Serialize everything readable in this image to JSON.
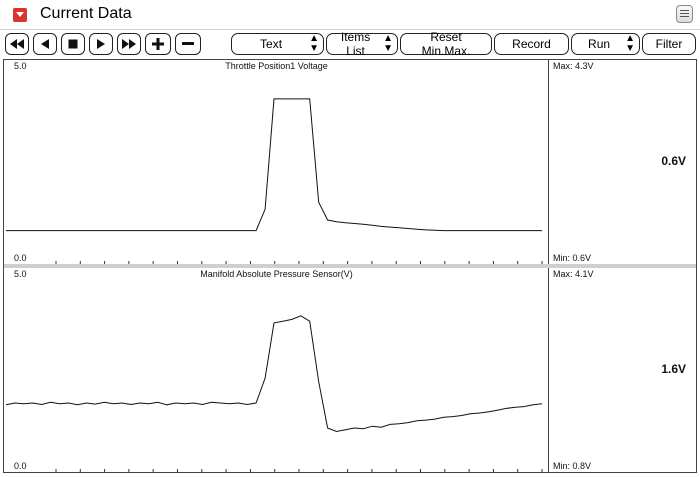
{
  "window": {
    "title": "Current Data"
  },
  "toolbar": {
    "text_select": "Text",
    "items_list": "Items List",
    "reset_label": "Reset Min.Max.",
    "record_label": "Record",
    "run_select": "Run",
    "filter_label": "Filter"
  },
  "panels": [
    {
      "title": "Throttle Position1 Voltage",
      "y_max_label": "5.0",
      "y_min_label": "0.0",
      "max_text": "Max:  4.3V",
      "min_text": "Min:  0.6V",
      "current_value": "0.6V",
      "chart_data": {
        "type": "line",
        "ylim": [
          0,
          5
        ],
        "x": [
          0,
          1,
          2,
          3,
          4,
          5,
          6,
          7,
          8,
          9,
          10,
          11,
          12,
          13,
          14,
          15,
          16,
          17,
          18,
          19,
          20,
          21,
          22,
          23,
          24,
          25,
          26,
          27,
          28,
          29,
          30,
          31,
          32,
          33,
          34,
          35,
          36,
          37,
          38,
          39,
          40,
          41,
          42,
          43,
          44,
          45,
          46,
          47,
          48,
          49,
          50,
          51,
          52,
          53,
          54,
          55,
          56,
          57,
          58,
          59,
          60
        ],
        "values": [
          0.6,
          0.6,
          0.6,
          0.6,
          0.6,
          0.6,
          0.6,
          0.6,
          0.6,
          0.6,
          0.6,
          0.6,
          0.6,
          0.6,
          0.6,
          0.6,
          0.6,
          0.6,
          0.6,
          0.6,
          0.6,
          0.6,
          0.6,
          0.6,
          0.6,
          0.6,
          0.6,
          0.6,
          0.6,
          1.2,
          4.3,
          4.3,
          4.3,
          4.3,
          4.3,
          1.4,
          0.9,
          0.85,
          0.82,
          0.8,
          0.78,
          0.75,
          0.72,
          0.7,
          0.68,
          0.66,
          0.64,
          0.62,
          0.61,
          0.6,
          0.6,
          0.6,
          0.6,
          0.6,
          0.6,
          0.6,
          0.6,
          0.6,
          0.6,
          0.6,
          0.6
        ]
      }
    },
    {
      "title": "Manifold Absolute Pressure Sensor(V)",
      "y_max_label": "5.0",
      "y_min_label": "0.0",
      "max_text": "Max:  4.1V",
      "min_text": "Min:  0.8V",
      "current_value": "1.6V",
      "chart_data": {
        "type": "line",
        "ylim": [
          0,
          5
        ],
        "x": [
          0,
          1,
          2,
          3,
          4,
          5,
          6,
          7,
          8,
          9,
          10,
          11,
          12,
          13,
          14,
          15,
          16,
          17,
          18,
          19,
          20,
          21,
          22,
          23,
          24,
          25,
          26,
          27,
          28,
          29,
          30,
          31,
          32,
          33,
          34,
          35,
          36,
          37,
          38,
          39,
          40,
          41,
          42,
          43,
          44,
          45,
          46,
          47,
          48,
          49,
          50,
          51,
          52,
          53,
          54,
          55,
          56,
          57,
          58,
          59,
          60
        ],
        "values": [
          1.55,
          1.6,
          1.58,
          1.6,
          1.56,
          1.62,
          1.58,
          1.6,
          1.55,
          1.6,
          1.57,
          1.62,
          1.58,
          1.6,
          1.56,
          1.6,
          1.58,
          1.62,
          1.55,
          1.6,
          1.58,
          1.6,
          1.56,
          1.62,
          1.6,
          1.58,
          1.6,
          1.56,
          1.6,
          2.3,
          3.85,
          3.9,
          3.95,
          4.05,
          3.9,
          2.2,
          0.9,
          0.8,
          0.85,
          0.9,
          0.88,
          0.95,
          0.92,
          1.0,
          1.02,
          1.05,
          1.1,
          1.12,
          1.15,
          1.2,
          1.22,
          1.25,
          1.3,
          1.32,
          1.35,
          1.4,
          1.45,
          1.48,
          1.5,
          1.55,
          1.58
        ]
      }
    }
  ]
}
